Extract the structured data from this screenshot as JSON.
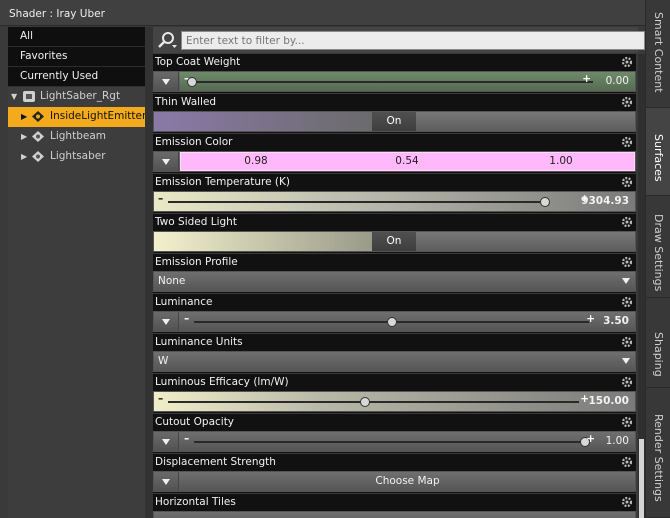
{
  "window": {
    "title": "Shader : Iray Uber"
  },
  "categories": [
    "All",
    "Favorites",
    "Currently Used"
  ],
  "tree": [
    {
      "label": "LightSaber_Rgt",
      "level": 0,
      "selected": false
    },
    {
      "label": "InsideLightEmitter",
      "level": 1,
      "selected": true
    },
    {
      "label": "Lightbeam",
      "level": 1,
      "selected": false
    },
    {
      "label": "Lightsaber",
      "level": 1,
      "selected": false
    }
  ],
  "filter": {
    "placeholder": "Enter text to filter by..."
  },
  "properties": {
    "top_coat_weight": {
      "label": "Top Coat Weight",
      "value": "0.00",
      "fraction": 0.0
    },
    "thin_walled": {
      "label": "Thin Walled",
      "state": "On"
    },
    "emission_color": {
      "label": "Emission Color",
      "r": "0.98",
      "g": "0.54",
      "b": "1.00",
      "color": "#ffb8fa"
    },
    "emission_temperature": {
      "label": "Emission Temperature (K)",
      "value": "9304.93",
      "fraction": 0.99
    },
    "two_sided_light": {
      "label": "Two Sided Light",
      "state": "On"
    },
    "emission_profile": {
      "label": "Emission Profile",
      "value": "None"
    },
    "luminance": {
      "label": "Luminance",
      "value": "3.50",
      "fraction": 0.5
    },
    "luminance_units": {
      "label": "Luminance Units",
      "value": "W"
    },
    "luminous_efficacy": {
      "label": "Luminous Efficacy (lm/W)",
      "value": "150.00",
      "fraction": 0.48
    },
    "cutout_opacity": {
      "label": "Cutout Opacity",
      "value": "1.00",
      "fraction": 1.0
    },
    "displacement_strength": {
      "label": "Displacement Strength",
      "button": "Choose Map"
    },
    "horizontal_tiles": {
      "label": "Horizontal Tiles"
    }
  },
  "tabs": [
    "Smart Content",
    "Surfaces",
    "Draw Settings",
    "Shaping",
    "Render Settings"
  ],
  "active_tab": "Surfaces",
  "colors": {
    "selection": "#f3aa1c",
    "emission": "#ffb8fa"
  }
}
